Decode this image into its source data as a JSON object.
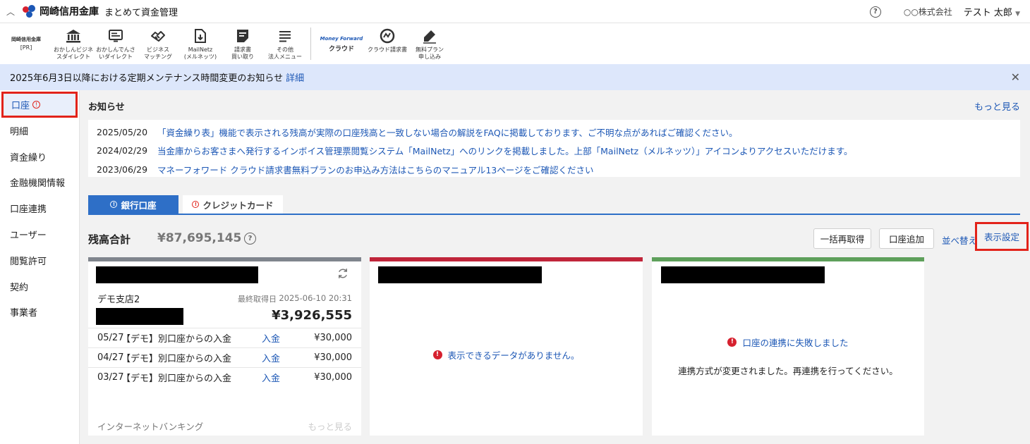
{
  "header": {
    "bank_name": "岡崎信用金庫",
    "app_name": "まとめて資金管理",
    "company": "○○株式会社",
    "user": "テスト 太郎"
  },
  "toolbar": {
    "brand": {
      "name": "岡崎信用金庫",
      "tag": "[PR]"
    },
    "tools": [
      {
        "icon": "bank-icon",
        "label": "おかしんビジネ\nスダイレクト"
      },
      {
        "icon": "monitor-icon",
        "label": "おかしんでんさ\nいダイレクト"
      },
      {
        "icon": "handshake-icon",
        "label": "ビジネス\nマッチング"
      },
      {
        "icon": "document-download-icon",
        "label": "MailNetz\n(メルネッツ)"
      },
      {
        "icon": "invoice-icon",
        "label": "請求書\n買い取り"
      },
      {
        "icon": "menu-icon",
        "label": "その他\n法人メニュー"
      }
    ],
    "mf": {
      "logo": "Money Forward",
      "sub": "クラウド"
    },
    "mf_tools": [
      {
        "icon": "mf-invoice-icon",
        "label": "クラウド請求書"
      },
      {
        "icon": "signup-pen-icon",
        "label": "無料プラン\n申し込み"
      }
    ]
  },
  "banner": {
    "text": "2025年6月3日以降における定期メンテナンス時間変更のお知らせ",
    "link": "詳細"
  },
  "sidebar": {
    "items": [
      {
        "label": "口座",
        "active": true
      },
      {
        "label": "明細"
      },
      {
        "label": "資金繰り"
      },
      {
        "label": "金融機関情報"
      },
      {
        "label": "口座連携"
      },
      {
        "label": "ユーザー"
      },
      {
        "label": "閲覧許可"
      },
      {
        "label": "契約"
      },
      {
        "label": "事業者"
      }
    ]
  },
  "news": {
    "title": "お知らせ",
    "more": "もっと見る",
    "items": [
      {
        "date": "2025/05/20",
        "text": "「資金繰り表」機能で表示される残高が実際の口座残高と一致しない場合の解説をFAQに掲載しております、ご不明な点があればご確認ください。"
      },
      {
        "date": "2024/02/29",
        "text": "当金庫からお客さまへ発行するインボイス管理票閲覧システム「MailNetz」へのリンクを掲載しました。上部「MailNetz（メルネッツ）」アイコンよりアクセスいただけます。"
      },
      {
        "date": "2023/06/29",
        "text": "マネーフォワード クラウド請求書無料プランのお申込み方法はこちらのマニュアル13ページをご確認ください"
      }
    ]
  },
  "tabs": [
    {
      "label": "銀行口座",
      "active": true
    },
    {
      "label": "クレジットカード",
      "active": false
    }
  ],
  "summary": {
    "label": "残高合計",
    "amount": "¥87,695,145",
    "buttons": {
      "refetch": "一括再取得",
      "add": "口座追加",
      "sort": "並べ替え",
      "display": "表示設定"
    }
  },
  "cards": [
    {
      "branch": "デモ支店2",
      "fetched_label": "最終取得日",
      "fetched_at": "2025-06-10 20:31",
      "balance": "¥3,926,555",
      "transactions": [
        {
          "date": "05/27",
          "desc": "【デモ】別口座からの入金",
          "type": "入金",
          "amount": "¥30,000"
        },
        {
          "date": "04/27",
          "desc": "【デモ】別口座からの入金",
          "type": "入金",
          "amount": "¥30,000"
        },
        {
          "date": "03/27",
          "desc": "【デモ】別口座からの入金",
          "type": "入金",
          "amount": "¥30,000"
        }
      ],
      "footer": "インターネットバンキング",
      "more": "もっと見る"
    },
    {
      "message": "表示できるデータがありません。"
    },
    {
      "message": "口座の連携に失敗しました",
      "detail": "連携方式が変更されました。再連携を行ってください。"
    }
  ]
}
